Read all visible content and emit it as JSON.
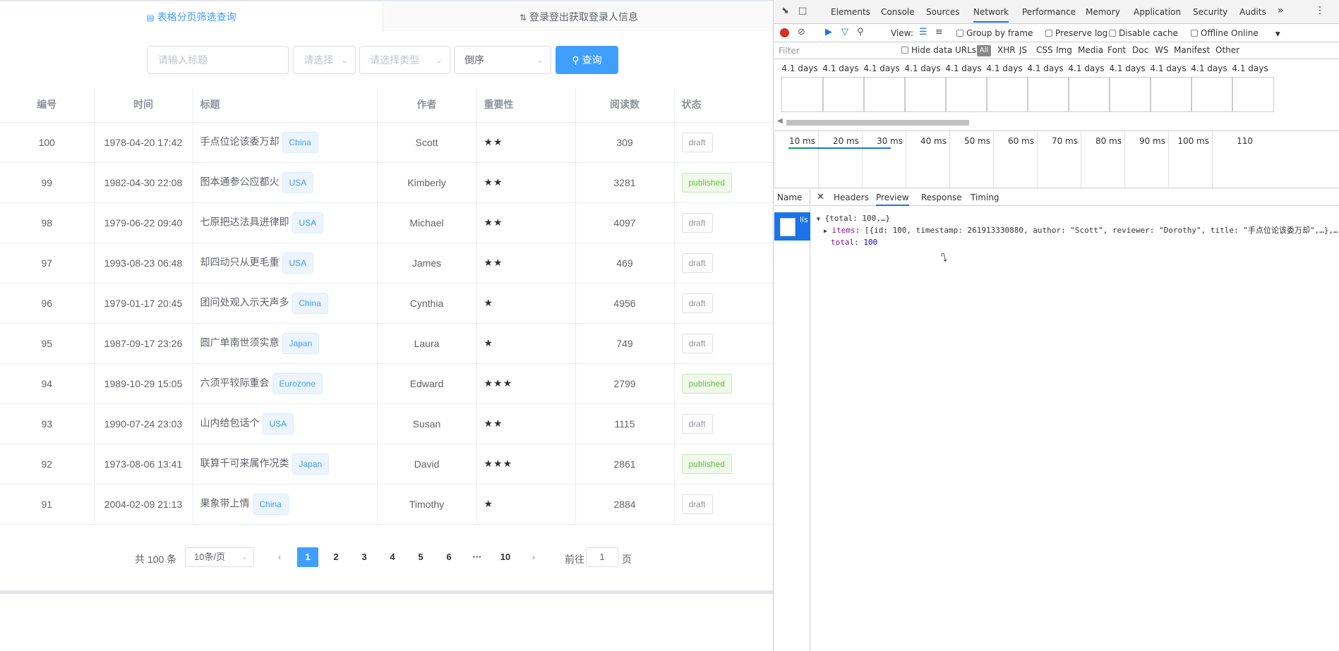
{
  "tabs": {
    "active": "表格分页筛选查询",
    "inactive": "登录登出获取登录人信息"
  },
  "filters": {
    "title_placeholder": "请输入标题",
    "select_placeholder": "请选择",
    "type_placeholder": "请选择类型",
    "sort_value": "倒序",
    "search_label": "查询"
  },
  "table": {
    "headers": [
      "编号",
      "时间",
      "标题",
      "作者",
      "重要性",
      "阅读数",
      "状态"
    ],
    "rows": [
      {
        "id": "100",
        "time": "1978-04-20 17:42",
        "title": "手点位论该委万却",
        "tag": "China",
        "author": "Scott",
        "stars": "★★",
        "reads": "309",
        "status": "draft"
      },
      {
        "id": "99",
        "time": "1982-04-30 22:08",
        "title": "图本通参公应都火",
        "tag": "USA",
        "author": "Kimberly",
        "stars": "★★",
        "reads": "3281",
        "status": "published"
      },
      {
        "id": "98",
        "time": "1979-06-22 09:40",
        "title": "七原把达法具进律即",
        "tag": "USA",
        "author": "Michael",
        "stars": "★★",
        "reads": "4097",
        "status": "draft"
      },
      {
        "id": "97",
        "time": "1993-08-23 06:48",
        "title": "却四动只从更毛重",
        "tag": "USA",
        "author": "James",
        "stars": "★★",
        "reads": "469",
        "status": "draft"
      },
      {
        "id": "96",
        "time": "1979-01-17 20:45",
        "title": "团问处观入示天声多",
        "tag": "China",
        "author": "Cynthia",
        "stars": "★",
        "reads": "4956",
        "status": "draft"
      },
      {
        "id": "95",
        "time": "1987-09-17 23:26",
        "title": "圆广单南世须实意",
        "tag": "Japan",
        "author": "Laura",
        "stars": "★",
        "reads": "749",
        "status": "draft"
      },
      {
        "id": "94",
        "time": "1989-10-29 15:05",
        "title": "六须平较际重会",
        "tag": "Eurozone",
        "author": "Edward",
        "stars": "★★★",
        "reads": "2799",
        "status": "published"
      },
      {
        "id": "93",
        "time": "1990-07-24 23:03",
        "title": "山内给包话个",
        "tag": "USA",
        "author": "Susan",
        "stars": "★★",
        "reads": "1115",
        "status": "draft"
      },
      {
        "id": "92",
        "time": "1973-08-06 13:41",
        "title": "联算千可来属作况类",
        "tag": "Japan",
        "author": "David",
        "stars": "★★★",
        "reads": "2861",
        "status": "published"
      },
      {
        "id": "91",
        "time": "2004-02-09 21:13",
        "title": "果象带上情",
        "tag": "China",
        "author": "Timothy",
        "stars": "★",
        "reads": "2884",
        "status": "draft"
      }
    ]
  },
  "pagination": {
    "total": "共 100 条",
    "page_size": "10条/页",
    "pages": [
      "1",
      "2",
      "3",
      "4",
      "5",
      "6",
      "···",
      "10"
    ],
    "current": "1",
    "goto_label": "前往",
    "goto_value": "1",
    "page_suffix": "页"
  },
  "devtools": {
    "tabs": [
      "Elements",
      "Console",
      "Sources",
      "Network",
      "Performance",
      "Memory",
      "Application",
      "Security",
      "Audits"
    ],
    "active_tab": "Network",
    "toolbar": {
      "view_label": "View:",
      "group_by_frame": "Group by frame",
      "preserve_log": "Preserve log",
      "disable_cache": "Disable cache",
      "offline": "Offline",
      "throttle": "Online"
    },
    "filter": {
      "placeholder": "Filter",
      "hide_data_urls": "Hide data URLs",
      "types": [
        "All",
        "XHR",
        "JS",
        "CSS",
        "Img",
        "Media",
        "Font",
        "Doc",
        "WS",
        "Manifest",
        "Other"
      ]
    },
    "frame_label": "4.1 days",
    "timeline_ticks": [
      "10 ms",
      "20 ms",
      "30 ms",
      "40 ms",
      "50 ms",
      "60 ms",
      "70 ms",
      "80 ms",
      "90 ms",
      "100 ms",
      "110"
    ],
    "name_header": "Name",
    "request_name": "lis",
    "subtabs": [
      "Headers",
      "Preview",
      "Response",
      "Timing"
    ],
    "active_subtab": "Preview",
    "preview": {
      "line1": "{total: 100,…}",
      "items_key": "items",
      "items_value": "[{id: 100, timestamp: 261913330880, author: \"Scott\", reviewer: \"Dorothy\", title: \"手点位论该委万却\",…},…",
      "total_key": "total",
      "total_value": "100"
    }
  }
}
